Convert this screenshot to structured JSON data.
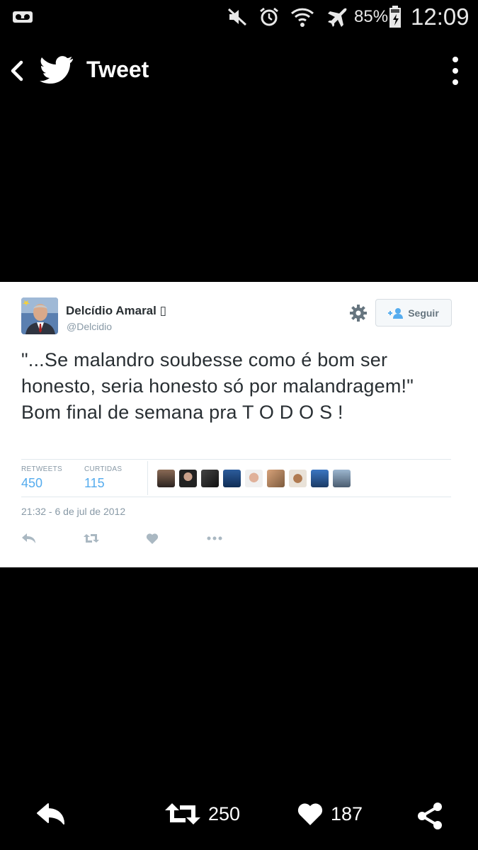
{
  "status_bar": {
    "battery": "85%",
    "time": "12:09",
    "icons": [
      "voicemail-icon",
      "mute-icon",
      "alarm-icon",
      "wifi-icon",
      "airplane-icon",
      "battery-icon"
    ]
  },
  "app_bar": {
    "title": "Tweet",
    "icons": [
      "back-icon",
      "twitter-bird-icon",
      "more-vert-icon"
    ]
  },
  "embedded_tweet": {
    "author_name": "Delcídio Amaral ▯",
    "author_handle": "@Delcidio",
    "follow_label": "Seguir",
    "text": "\"...Se malandro soubesse como é bom ser honesto, seria honesto só por malandragem!\" Bom final de semana pra T O D O S !",
    "retweets_label": "RETWEETS",
    "retweets_value": "450",
    "likes_label": "CURTIDAS",
    "likes_value": "115",
    "timestamp": "21:32 - 6 de jul de 2012",
    "action_icons": [
      "reply-icon",
      "retweet-icon",
      "heart-icon",
      "more-dots-icon"
    ],
    "accent": "#55acee"
  },
  "bottom_bar": {
    "retweet_count": "250",
    "like_count": "187",
    "icons": [
      "reply-icon",
      "retweet-icon",
      "heart-icon",
      "share-icon"
    ]
  }
}
